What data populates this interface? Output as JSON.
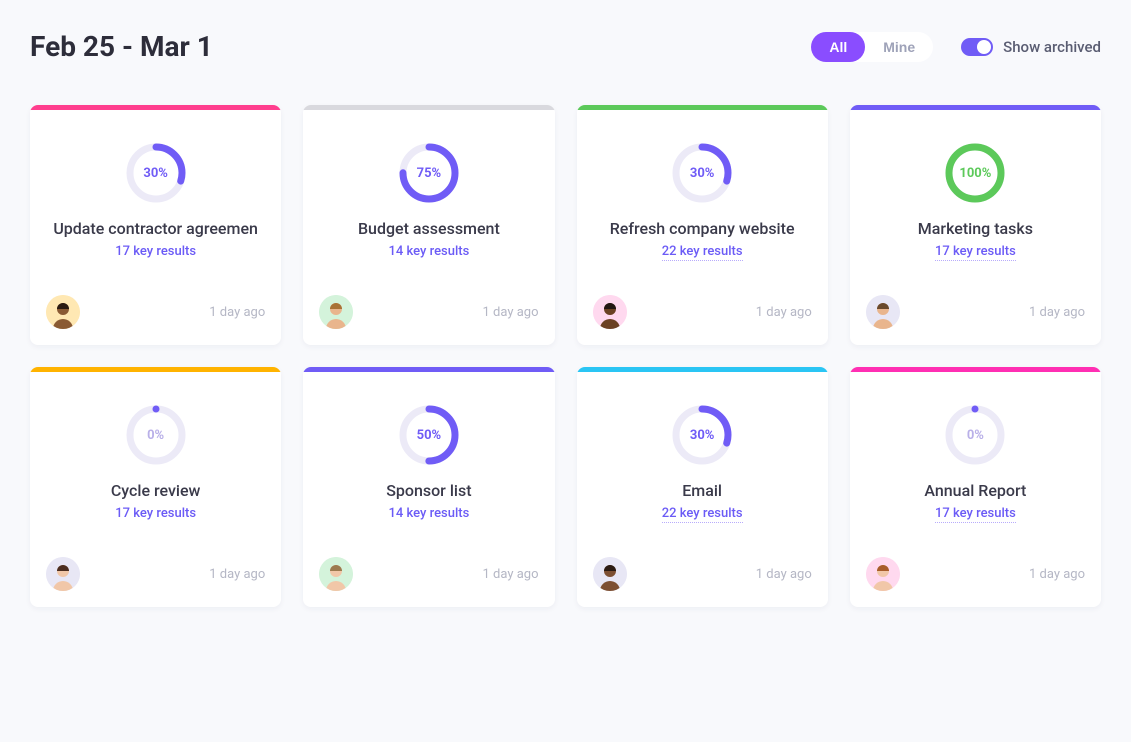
{
  "header": {
    "title": "Feb 25 - Mar 1",
    "filters": {
      "all": "All",
      "mine": "Mine"
    },
    "archived_label": "Show archived",
    "archived_on": true
  },
  "colors": {
    "purple": "#705cf6",
    "green": "#5cc95a"
  },
  "cards": [
    {
      "accent": "#ff3e8e",
      "progress": 30,
      "progress_text": "30%",
      "ring_color": "#705cf6",
      "pct_color": "#705cf6",
      "title": "Update contractor agreemen",
      "subtitle": "17 key results",
      "underlined": false,
      "avatar_bg": "#ffe8b3",
      "avatar_skin": "#8a5a33",
      "avatar_hair": "#2b1b12",
      "time": "1 day ago"
    },
    {
      "accent": "#d9d9de",
      "progress": 75,
      "progress_text": "75%",
      "ring_color": "#705cf6",
      "pct_color": "#705cf6",
      "title": "Budget assessment",
      "subtitle": "14 key results",
      "underlined": false,
      "avatar_bg": "#d4f3db",
      "avatar_skin": "#e9b58d",
      "avatar_hair": "#a97236",
      "time": "1 day ago"
    },
    {
      "accent": "#5cc95a",
      "progress": 30,
      "progress_text": "30%",
      "ring_color": "#705cf6",
      "pct_color": "#705cf6",
      "title": "Refresh company website",
      "subtitle": "22 key results",
      "underlined": true,
      "avatar_bg": "#ffd9ef",
      "avatar_skin": "#6b4123",
      "avatar_hair": "#231712",
      "time": "1 day ago"
    },
    {
      "accent": "#705cf6",
      "progress": 100,
      "progress_text": "100%",
      "ring_color": "#5cc95a",
      "pct_color": "#5cc95a",
      "title": "Marketing tasks",
      "subtitle": "17 key results",
      "underlined": true,
      "avatar_bg": "#e8e7f5",
      "avatar_skin": "#e9b58d",
      "avatar_hair": "#6a4a2c",
      "time": "1 day ago"
    },
    {
      "accent": "#ffb300",
      "progress": 0,
      "progress_text": "0%",
      "ring_color": "#705cf6",
      "pct_color": "#b9b0e8",
      "title": "Cycle review",
      "subtitle": "17 key results",
      "underlined": false,
      "avatar_bg": "#e8e7f5",
      "avatar_skin": "#f1c7a8",
      "avatar_hair": "#4c2d1f",
      "time": "1 day ago"
    },
    {
      "accent": "#705cf6",
      "progress": 50,
      "progress_text": "50%",
      "ring_color": "#705cf6",
      "pct_color": "#705cf6",
      "title": "Sponsor list",
      "subtitle": "14 key results",
      "underlined": false,
      "avatar_bg": "#d4f3db",
      "avatar_skin": "#f1c7a8",
      "avatar_hair": "#9c7a4f",
      "time": "1 day ago"
    },
    {
      "accent": "#2ac5f4",
      "progress": 30,
      "progress_text": "30%",
      "ring_color": "#705cf6",
      "pct_color": "#705cf6",
      "title": "Email",
      "subtitle": "22 key results",
      "underlined": true,
      "avatar_bg": "#e8e7f5",
      "avatar_skin": "#7d4f32",
      "avatar_hair": "#2b1b12",
      "time": "1 day ago"
    },
    {
      "accent": "#ff2fb3",
      "progress": 0,
      "progress_text": "0%",
      "ring_color": "#705cf6",
      "pct_color": "#b9b0e8",
      "title": "Annual Report",
      "subtitle": "17 key results",
      "underlined": true,
      "avatar_bg": "#ffd9ef",
      "avatar_skin": "#f1c7a8",
      "avatar_hair": "#a85c2a",
      "time": "1 day ago"
    }
  ]
}
